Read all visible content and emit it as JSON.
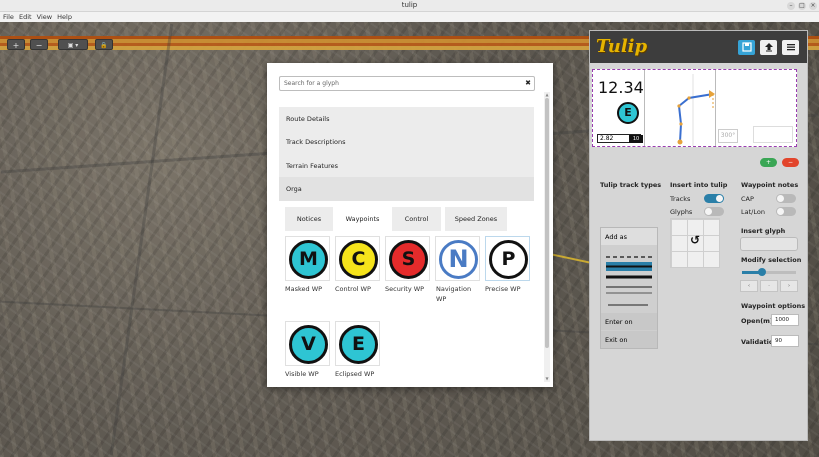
{
  "window": {
    "title": "tulip",
    "controls": [
      "–",
      "□",
      "×"
    ]
  },
  "menu": [
    "File",
    "Edit",
    "View",
    "Help"
  ],
  "map_toolbar": {
    "zoom_in": "+",
    "zoom_out": "−",
    "layers": "▣ ▾",
    "lock": "🔒"
  },
  "glyph_dialog": {
    "search_placeholder": "Search for a glyph",
    "clear": "✖",
    "sections": [
      "Route Details",
      "Track Descriptions",
      "Terrain Features",
      "Orga"
    ],
    "tabs": [
      "Notices",
      "Waypoints",
      "Control",
      "Speed Zones"
    ],
    "glyphs": [
      {
        "letter": "M",
        "label": "Masked WP",
        "color": "#2ec5d3"
      },
      {
        "letter": "C",
        "label": "Control WP",
        "color": "#f5e31b"
      },
      {
        "letter": "S",
        "label": "Security WP",
        "color": "#e52b2b"
      },
      {
        "letter": "N",
        "label": "Navigation",
        "label2": "WP",
        "color": "#ffffff"
      },
      {
        "letter": "P",
        "label": "Precise WP",
        "color": "#ffffff"
      },
      {
        "letter": "V",
        "label": "Visible WP",
        "color": "#2ec5d3"
      },
      {
        "letter": "E",
        "label": "Eclipsed WP",
        "color": "#2ec5d3"
      }
    ]
  },
  "panel": {
    "logo": "Tulip",
    "preview": {
      "distance": "12.34",
      "glyph": "E",
      "partial": "2.82",
      "badge": "10",
      "heading": "300°"
    },
    "track_types": {
      "title": "Tulip track types",
      "add_as": "Add as",
      "enter_on": "Enter on",
      "exit_on": "Exit on"
    },
    "insert": {
      "title": "Insert into tulip",
      "tracks": "Tracks",
      "glyphs": "Glyphs",
      "symbol": "↺"
    },
    "waypoint_notes": {
      "title": "Waypoint notes",
      "cap": "CAP",
      "latlon": "Lat/Lon"
    },
    "insert_glyph": "Insert glyph",
    "modify_selection": "Modify selection",
    "arrows": [
      "‹",
      "·",
      "›"
    ],
    "waypoint_options": {
      "title": "Waypoint options",
      "open_label": "Open(m):",
      "open_value": "1000",
      "validation_label": "Validation:",
      "validation_value": "90"
    },
    "plus": "+",
    "minus": "−"
  }
}
